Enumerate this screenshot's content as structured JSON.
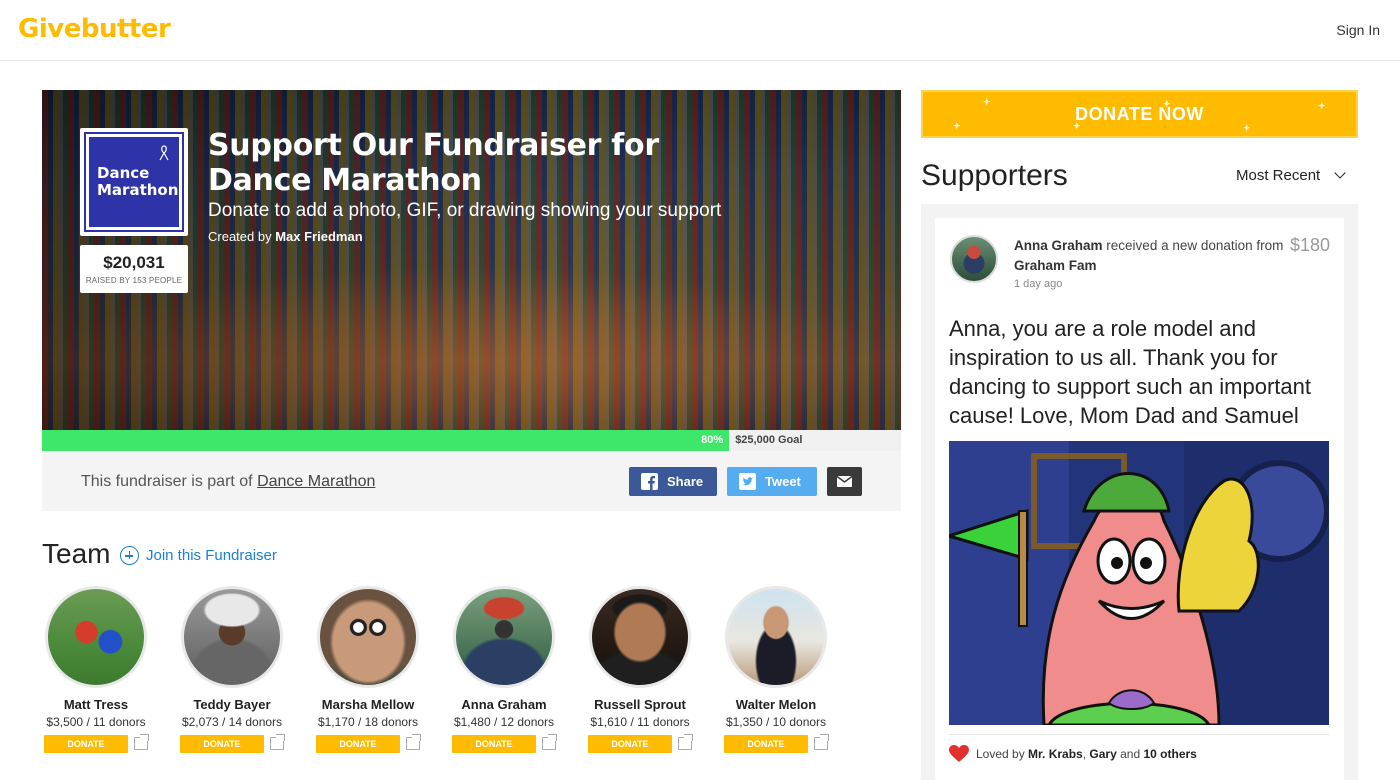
{
  "header": {
    "logo": "Givebutter",
    "sign_in": "Sign In"
  },
  "campaign": {
    "team_logo_line1": "Dance",
    "team_logo_line2": "Marathon",
    "raised": "$20,031",
    "raised_sub": "RAISED BY 153 PEOPLE",
    "title_line1": "Support Our Fundraiser for",
    "title_line2": "Dance Marathon",
    "subtitle": "Donate to add a photo, GIF, or drawing showing your support",
    "created_by_label": "Created by",
    "creator": "Max Friedman",
    "progress_percent": 80,
    "progress_label": "80%",
    "goal": "$25,000 Goal",
    "part_of_text": "This fundraiser is part of",
    "part_of_link": "Dance Marathon",
    "share_label": "Share",
    "tweet_label": "Tweet"
  },
  "team": {
    "heading": "Team",
    "join_label": "Join this Fundraiser",
    "donate_label": "DONATE",
    "members": [
      {
        "name": "Matt Tress",
        "stats": "$3,500 / 11 donors"
      },
      {
        "name": "Teddy Bayer",
        "stats": "$2,073 / 14 donors"
      },
      {
        "name": "Marsha Mellow",
        "stats": "$1,170 / 18 donors"
      },
      {
        "name": "Anna Graham",
        "stats": "$1,480 / 12 donors"
      },
      {
        "name": "Russell Sprout",
        "stats": "$1,610 / 11 donors"
      },
      {
        "name": "Walter Melon",
        "stats": "$1,350 / 10 donors"
      }
    ]
  },
  "sidebar": {
    "donate_now": "DONATE NOW",
    "supporters_heading": "Supporters",
    "sort_value": "Most Recent",
    "card": {
      "recipient": "Anna Graham",
      "received_text": "received a new donation from",
      "donor": "Graham Fam",
      "time": "1 day ago",
      "amount": "$180",
      "message": "Anna, you are a role model and inspiration to us all. Thank you for dancing to support such an important cause! Love, Mom Dad and Samuel",
      "loved_prefix": "Loved by",
      "loved_name1": "Mr. Krabs",
      "loved_name2": "Gary",
      "loved_and": "and",
      "loved_others": "10 others"
    }
  },
  "colors": {
    "brand": "#FFBB00",
    "progress": "#3EE66A",
    "facebook": "#3B5998",
    "twitter": "#55ACEE",
    "link": "#1A7FD6"
  }
}
